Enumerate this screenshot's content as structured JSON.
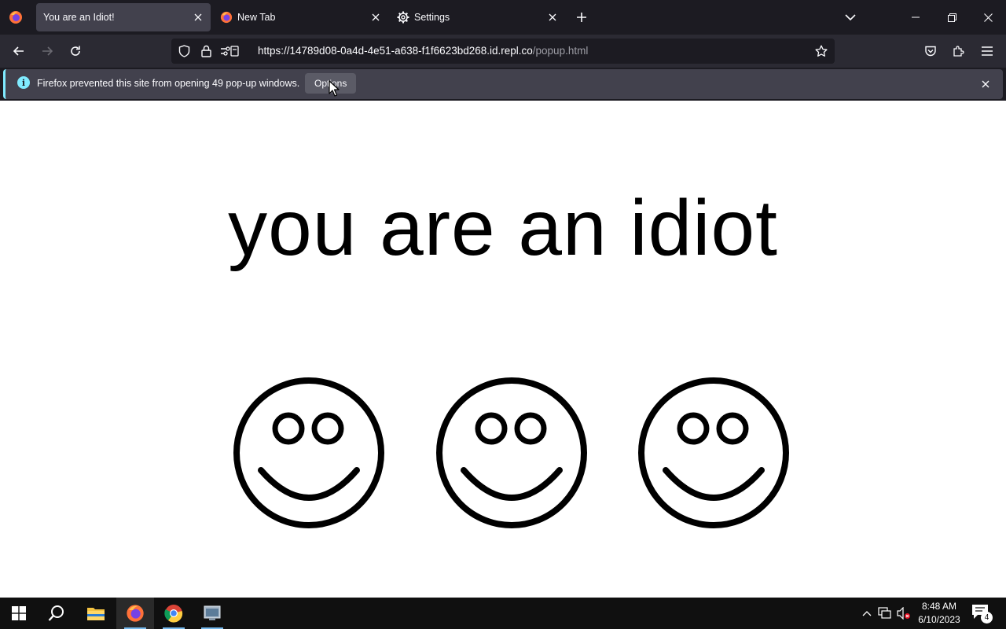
{
  "tabs": [
    {
      "title": "You are an Idiot!",
      "icon": "firefox-icon",
      "active": true
    },
    {
      "title": "New Tab",
      "icon": "firefox-icon",
      "active": false
    },
    {
      "title": "Settings",
      "icon": "gear-icon",
      "active": false
    }
  ],
  "address": {
    "url_main": "https://14789d08-0a4d-4e51-a638-f1f6623bd268.id.repl.co",
    "url_path": "/popup.html"
  },
  "notification": {
    "message": "Firefox prevented this site from opening 49 pop-up windows.",
    "options_label": "Options"
  },
  "page": {
    "headline": "you are an idiot",
    "smiley_count": 3
  },
  "taskbar": {
    "time": "8:48 AM",
    "date": "6/10/2023",
    "notification_count": "4"
  },
  "colors": {
    "accent": "#80ebff",
    "tab_active": "#42414d",
    "toolbar": "#2b2a33",
    "frame": "#1c1b22"
  }
}
